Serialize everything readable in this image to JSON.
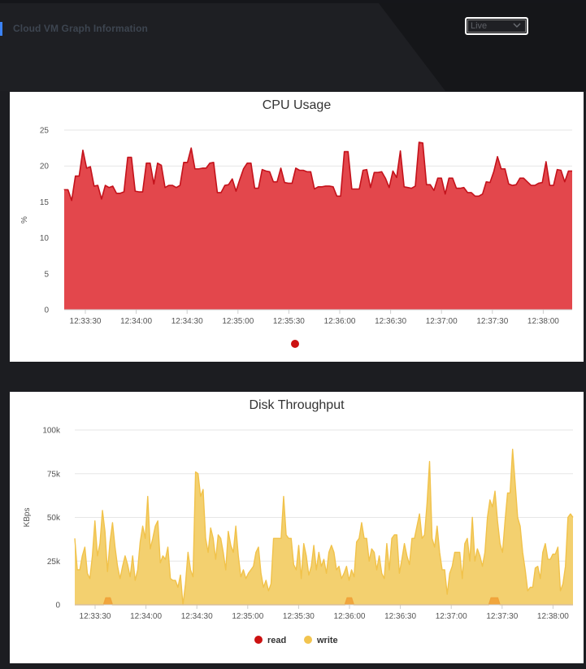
{
  "header": {
    "title": "Cloud VM Graph Information",
    "range_select": {
      "value": "Live",
      "icon": "chevron-down-icon"
    }
  },
  "colors": {
    "accent": "#3b82f6",
    "cpu": "#e0242c",
    "cpu_fill": "#e3474c",
    "read": "#cc1111",
    "write": "#f2c44f"
  },
  "charts": [
    {
      "id": "cpu",
      "type": "area",
      "title": "CPU Usage",
      "ylabel": "%",
      "ylim": [
        0,
        25
      ],
      "yticks": [
        0,
        5,
        10,
        15,
        20,
        25
      ],
      "xticks": [
        "12:33:30",
        "12:34:00",
        "12:34:30",
        "12:35:00",
        "12:35:30",
        "12:36:00",
        "12:36:30",
        "12:37:00",
        "12:37:30",
        "12:38:00"
      ],
      "grid": true,
      "legend_position": "bottom-center",
      "series": [
        {
          "name": "",
          "color": "#e0242c",
          "values": [
            16.7,
            16.7,
            15.2,
            18.6,
            18.6,
            22.2,
            19.7,
            19.9,
            17.2,
            17.3,
            15.4,
            17.3,
            17.0,
            17.2,
            16.2,
            16.2,
            16.4,
            21.2,
            21.2,
            16.5,
            16.4,
            16.4,
            20.4,
            20.4,
            17.5,
            20.4,
            20.1,
            17.0,
            17.3,
            17.3,
            17.0,
            17.3,
            20.5,
            20.5,
            22.5,
            19.6,
            19.6,
            19.7,
            19.7,
            20.4,
            20.5,
            16.3,
            16.3,
            17.3,
            17.4,
            18.2,
            16.5,
            18.1,
            19.6,
            20.4,
            20.4,
            16.9,
            16.9,
            19.5,
            19.3,
            19.2,
            17.8,
            17.8,
            19.7,
            17.7,
            17.6,
            17.6,
            19.7,
            19.4,
            19.4,
            19.2,
            19.2,
            16.8,
            17.1,
            17.1,
            17.2,
            17.2,
            17.1,
            15.8,
            15.8,
            22.0,
            22.0,
            16.8,
            16.8,
            16.8,
            19.4,
            19.5,
            17.0,
            19.1,
            19.1,
            19.2,
            18.3,
            17.0,
            19.3,
            18.4,
            22.1,
            17.1,
            17.0,
            16.9,
            17.2,
            23.3,
            23.2,
            17.4,
            17.4,
            16.6,
            18.3,
            18.3,
            16.1,
            18.3,
            18.3,
            16.9,
            16.9,
            17.0,
            16.3,
            16.3,
            15.8,
            15.8,
            16.1,
            17.8,
            17.7,
            19.2,
            21.3,
            19.6,
            19.6,
            17.5,
            17.3,
            17.4,
            18.3,
            18.3,
            17.8,
            17.3,
            17.3,
            17.6,
            17.7,
            20.6,
            17.3,
            17.3,
            19.5,
            19.4,
            17.8,
            19.3,
            19.3
          ]
        }
      ]
    },
    {
      "id": "disk",
      "type": "area",
      "title": "Disk Throughput",
      "ylabel": "KBps",
      "ylim": [
        0,
        100000
      ],
      "yticks": [
        0,
        25000,
        50000,
        75000,
        100000
      ],
      "ytick_labels": [
        "0",
        "25k",
        "50k",
        "75k",
        "100k"
      ],
      "xticks": [
        "12:33:30",
        "12:34:00",
        "12:34:30",
        "12:35:00",
        "12:35:30",
        "12:36:00",
        "12:36:30",
        "12:37:00",
        "12:37:30",
        "12:38:00"
      ],
      "grid": true,
      "legend_position": "bottom-center",
      "series": [
        {
          "name": "read",
          "color": "#cc1111",
          "values": [
            0,
            0,
            0,
            0,
            0,
            0,
            0,
            0,
            0,
            0,
            0,
            0,
            0,
            0,
            4000,
            4000,
            4000,
            0,
            0,
            0,
            0,
            0,
            0,
            0,
            0,
            0,
            0,
            0,
            0,
            0,
            0,
            0,
            0,
            0,
            0,
            0,
            0,
            0,
            0,
            0,
            0,
            0,
            0,
            0,
            0,
            0,
            0,
            0,
            0,
            0,
            0,
            0,
            0,
            0,
            0,
            0,
            0,
            0,
            0,
            0,
            0,
            0,
            0,
            0,
            0,
            0,
            0,
            0,
            0,
            0,
            0,
            0,
            0,
            0,
            0,
            0,
            0,
            0,
            0,
            0,
            0,
            0,
            0,
            0,
            0,
            0,
            0,
            0,
            0,
            0,
            0,
            0,
            0,
            0,
            0,
            0,
            0,
            0,
            0,
            0,
            0,
            0,
            0,
            0,
            0,
            0,
            0,
            0,
            0,
            0,
            0,
            0,
            0,
            0,
            0,
            0,
            0,
            0,
            0,
            0,
            0,
            0,
            0,
            4000,
            4000,
            4000,
            0,
            0,
            0,
            0,
            0,
            0,
            0,
            0,
            0,
            0,
            0,
            0,
            0,
            0,
            0,
            0,
            0,
            0,
            0,
            0,
            0,
            0,
            0,
            0,
            0,
            0,
            0,
            0,
            0,
            0,
            0,
            0,
            0,
            0,
            0,
            0,
            0,
            0,
            0,
            0,
            0,
            0,
            0,
            0,
            0,
            0,
            0,
            0,
            0,
            0,
            0,
            0,
            0,
            0,
            0,
            0,
            0,
            0,
            0,
            0,
            0,
            0,
            4000,
            4000,
            4000,
            4000,
            0,
            0,
            0,
            0,
            0,
            0,
            0,
            0,
            0,
            0,
            0,
            0,
            0,
            0,
            0,
            0,
            0,
            0,
            0,
            0,
            0,
            0,
            0,
            0,
            0,
            0,
            0,
            0,
            0,
            0,
            0,
            0,
            0,
            0
          ]
        },
        {
          "name": "write",
          "color": "#f2c44f",
          "values": [
            38000,
            20000,
            20000,
            28000,
            33000,
            18000,
            15000,
            28000,
            48000,
            28000,
            35000,
            54000,
            42000,
            19000,
            36000,
            47000,
            33000,
            22000,
            15000,
            22000,
            28000,
            23000,
            16000,
            28000,
            14000,
            20000,
            36000,
            45000,
            38000,
            62000,
            32000,
            38000,
            45000,
            48000,
            24000,
            28000,
            26000,
            33000,
            15000,
            14000,
            14000,
            10000,
            17000,
            0,
            12000,
            30000,
            20000,
            16000,
            76000,
            75000,
            62000,
            66000,
            38000,
            30000,
            44000,
            38000,
            26000,
            40000,
            38000,
            30000,
            20000,
            42000,
            34000,
            30000,
            45000,
            28000,
            16000,
            20000,
            15000,
            18000,
            20000,
            22000,
            30000,
            33000,
            18000,
            10000,
            14000,
            8000,
            12000,
            38000,
            38000,
            38000,
            38000,
            62000,
            40000,
            38000,
            38000,
            23000,
            20000,
            34000,
            15000,
            35000,
            28000,
            17000,
            22000,
            34000,
            20000,
            30000,
            22000,
            26000,
            18000,
            30000,
            34000,
            30000,
            20000,
            22000,
            15000,
            18000,
            22000,
            14000,
            20000,
            16000,
            36000,
            38000,
            47000,
            38000,
            38000,
            25000,
            32000,
            30000,
            20000,
            28000,
            18000,
            15000,
            35000,
            20000,
            38000,
            40000,
            40000,
            18000,
            26000,
            35000,
            28000,
            23000,
            38000,
            38000,
            45000,
            52000,
            38000,
            40000,
            58000,
            82000,
            38000,
            33000,
            45000,
            30000,
            20000,
            20000,
            6000,
            18000,
            22000,
            30000,
            30000,
            30000,
            15000,
            35000,
            38000,
            25000,
            50000,
            25000,
            32000,
            28000,
            22000,
            30000,
            50000,
            60000,
            56000,
            65000,
            48000,
            35000,
            30000,
            48000,
            64000,
            64000,
            89000,
            70000,
            50000,
            45000,
            30000,
            20000,
            8000,
            10000,
            10000,
            21000,
            22000,
            15000,
            30000,
            35000,
            26000,
            26000,
            29000,
            29000,
            33000,
            8000,
            12000,
            22000,
            50000,
            52000,
            50000
          ]
        }
      ]
    }
  ]
}
